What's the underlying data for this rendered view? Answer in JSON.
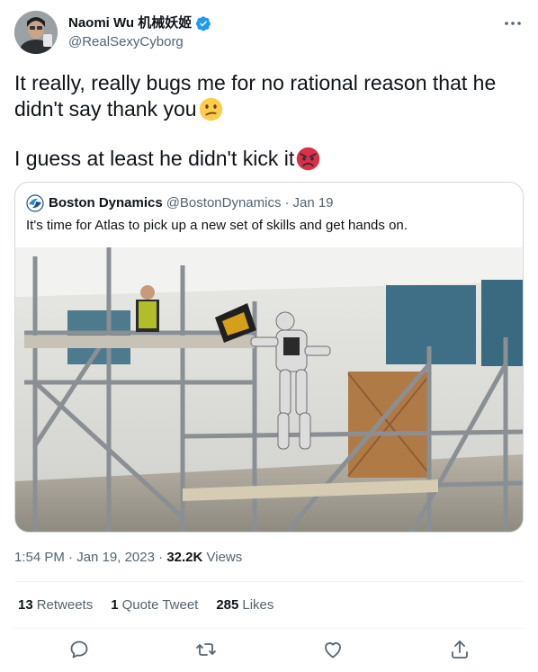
{
  "author": {
    "name": "Naomi Wu 机械妖姬",
    "handle": "@RealSexyCyborg",
    "verified": true
  },
  "tweet": {
    "line1": "It really, really bugs me for no rational reason that he",
    "line2": "didn't say thank you",
    "line3": "I guess at least he didn't kick it",
    "emoji1": "confused-face",
    "emoji2": "angry-face"
  },
  "quoted": {
    "name": "Boston Dynamics",
    "handle": "@BostonDynamics",
    "separator": "·",
    "date": "Jan 19",
    "text": "It's time for Atlas to pick up a new set of skills and get hands on.",
    "media": "Atlas robot tossing a tool bag up to a worker on scaffolding"
  },
  "meta": {
    "time": "1:54 PM",
    "separator": "·",
    "date": "Jan 19, 2023",
    "separator2": "·",
    "views_count": "32.2K",
    "views_label": "Views"
  },
  "stats": {
    "retweets_count": "13",
    "retweets_label": "Retweets",
    "quotes_count": "1",
    "quotes_label": "Quote Tweet",
    "likes_count": "285",
    "likes_label": "Likes"
  },
  "colors": {
    "text": "#0f1419",
    "secondary": "#536471",
    "border": "#cfd9de",
    "verified": "#1d9bf0"
  },
  "icons": [
    "more-icon",
    "verified-badge-icon",
    "reply-icon",
    "retweet-icon",
    "like-icon",
    "share-icon"
  ]
}
